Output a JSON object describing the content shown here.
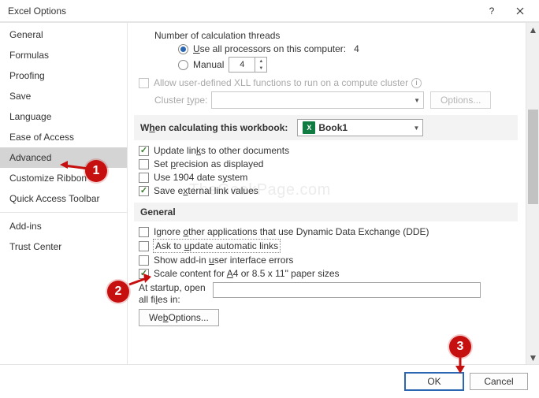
{
  "window": {
    "title": "Excel Options"
  },
  "sidebar": {
    "items": [
      {
        "label": "General"
      },
      {
        "label": "Formulas"
      },
      {
        "label": "Proofing"
      },
      {
        "label": "Save"
      },
      {
        "label": "Language"
      },
      {
        "label": "Ease of Access"
      },
      {
        "label": "Advanced",
        "selected": true
      },
      {
        "label": "Customize Ribbon"
      },
      {
        "label": "Quick Access Toolbar"
      },
      {
        "label": "Add-ins"
      },
      {
        "label": "Trust Center"
      }
    ]
  },
  "calc": {
    "threads_label": "Number of calculation threads",
    "use_all_label": "Use all processors on this computer:",
    "use_all_count": "4",
    "manual_label": "Manual",
    "manual_value": "4",
    "allow_xll_label": "Allow user-defined XLL functions to run on a compute cluster",
    "cluster_type_label": "Cluster type:",
    "options_btn": "Options..."
  },
  "workbook": {
    "header": "When calculating this workbook:",
    "dropdown_value": "Book1",
    "update_links": "Update links to other documents",
    "set_precision": "Set precision as displayed",
    "use_1904": "Use 1904 date system",
    "save_ext_link": "Save external link values"
  },
  "general": {
    "header": "General",
    "ignore_dde": "Ignore other applications that use Dynamic Data Exchange (DDE)",
    "ask_update": "Ask to update automatic links",
    "show_addin": "Show add-in user interface errors",
    "scale_content": "Scale content for A4 or 8.5 x 11\" paper sizes",
    "startup_label_1": "At startup, open",
    "startup_label_2": "all files in:",
    "web_options": "Web Options..."
  },
  "footer": {
    "ok": "OK",
    "cancel": "Cancel"
  },
  "markers": {
    "m1": "1",
    "m2": "2",
    "m3": "3"
  },
  "watermark": "TheGeekPage.com"
}
